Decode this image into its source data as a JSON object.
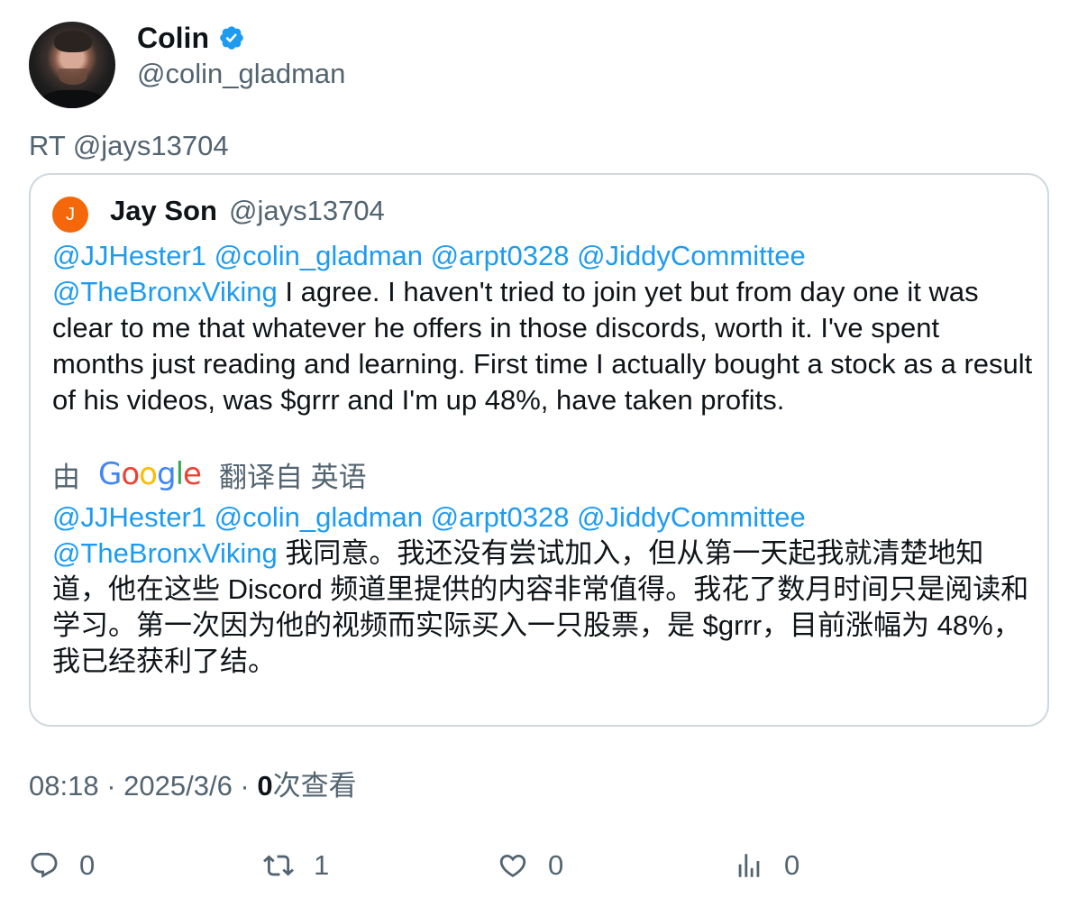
{
  "author": {
    "name": "Colin",
    "handle": "@colin_gladman",
    "verified_color": "#1d9bf0"
  },
  "retweet_line": "RT @jays13704",
  "quoted": {
    "avatar_letter": "J",
    "avatar_color": "#f4670a",
    "name": "Jay Son",
    "handle": "@jays13704",
    "original": {
      "mentions_line1": "@JJHester1 @colin_gladman @arpt0328 @JiddyCommittee",
      "mention_last": "@TheBronxViking",
      "body": " I agree. I haven't tried to join yet but from day one it was clear to me that whatever he offers in those discords, worth it. I've spent months just reading and learning. First time I actually bought a stock as a result of his videos, was $grrr and I'm up 48%, have taken profits."
    },
    "translation": {
      "by_label": "由",
      "google_logo": "Google",
      "from_label": "翻译自 英语"
    },
    "translated": {
      "mentions_line1": "@JJHester1 @colin_gladman @arpt0328 @JiddyCommittee",
      "mention_last": "@TheBronxViking",
      "body": " 我同意。我还没有尝试加入，但从第一天起我就清楚地知道，他在这些 Discord 频道里提供的内容非常值得。我花了数月时间只是阅读和学习。第一次因为他的视频而实际买入一只股票，是 $grrr，目前涨幅为 48%，我已经获利了结。"
    }
  },
  "meta": {
    "time": "08:18",
    "date": "2025/3/6",
    "separator": " · ",
    "views_count": "0",
    "views_label": "次查看"
  },
  "actions": {
    "replies": "0",
    "retweets": "1",
    "likes": "0",
    "views": "0"
  },
  "colors": {
    "accent": "#1d9bf0",
    "muted": "#536471",
    "text": "#0f1419",
    "border": "#cfd9de"
  },
  "icons": [
    "verified-badge-icon",
    "reply-icon",
    "retweet-icon",
    "like-icon",
    "analytics-icon"
  ]
}
